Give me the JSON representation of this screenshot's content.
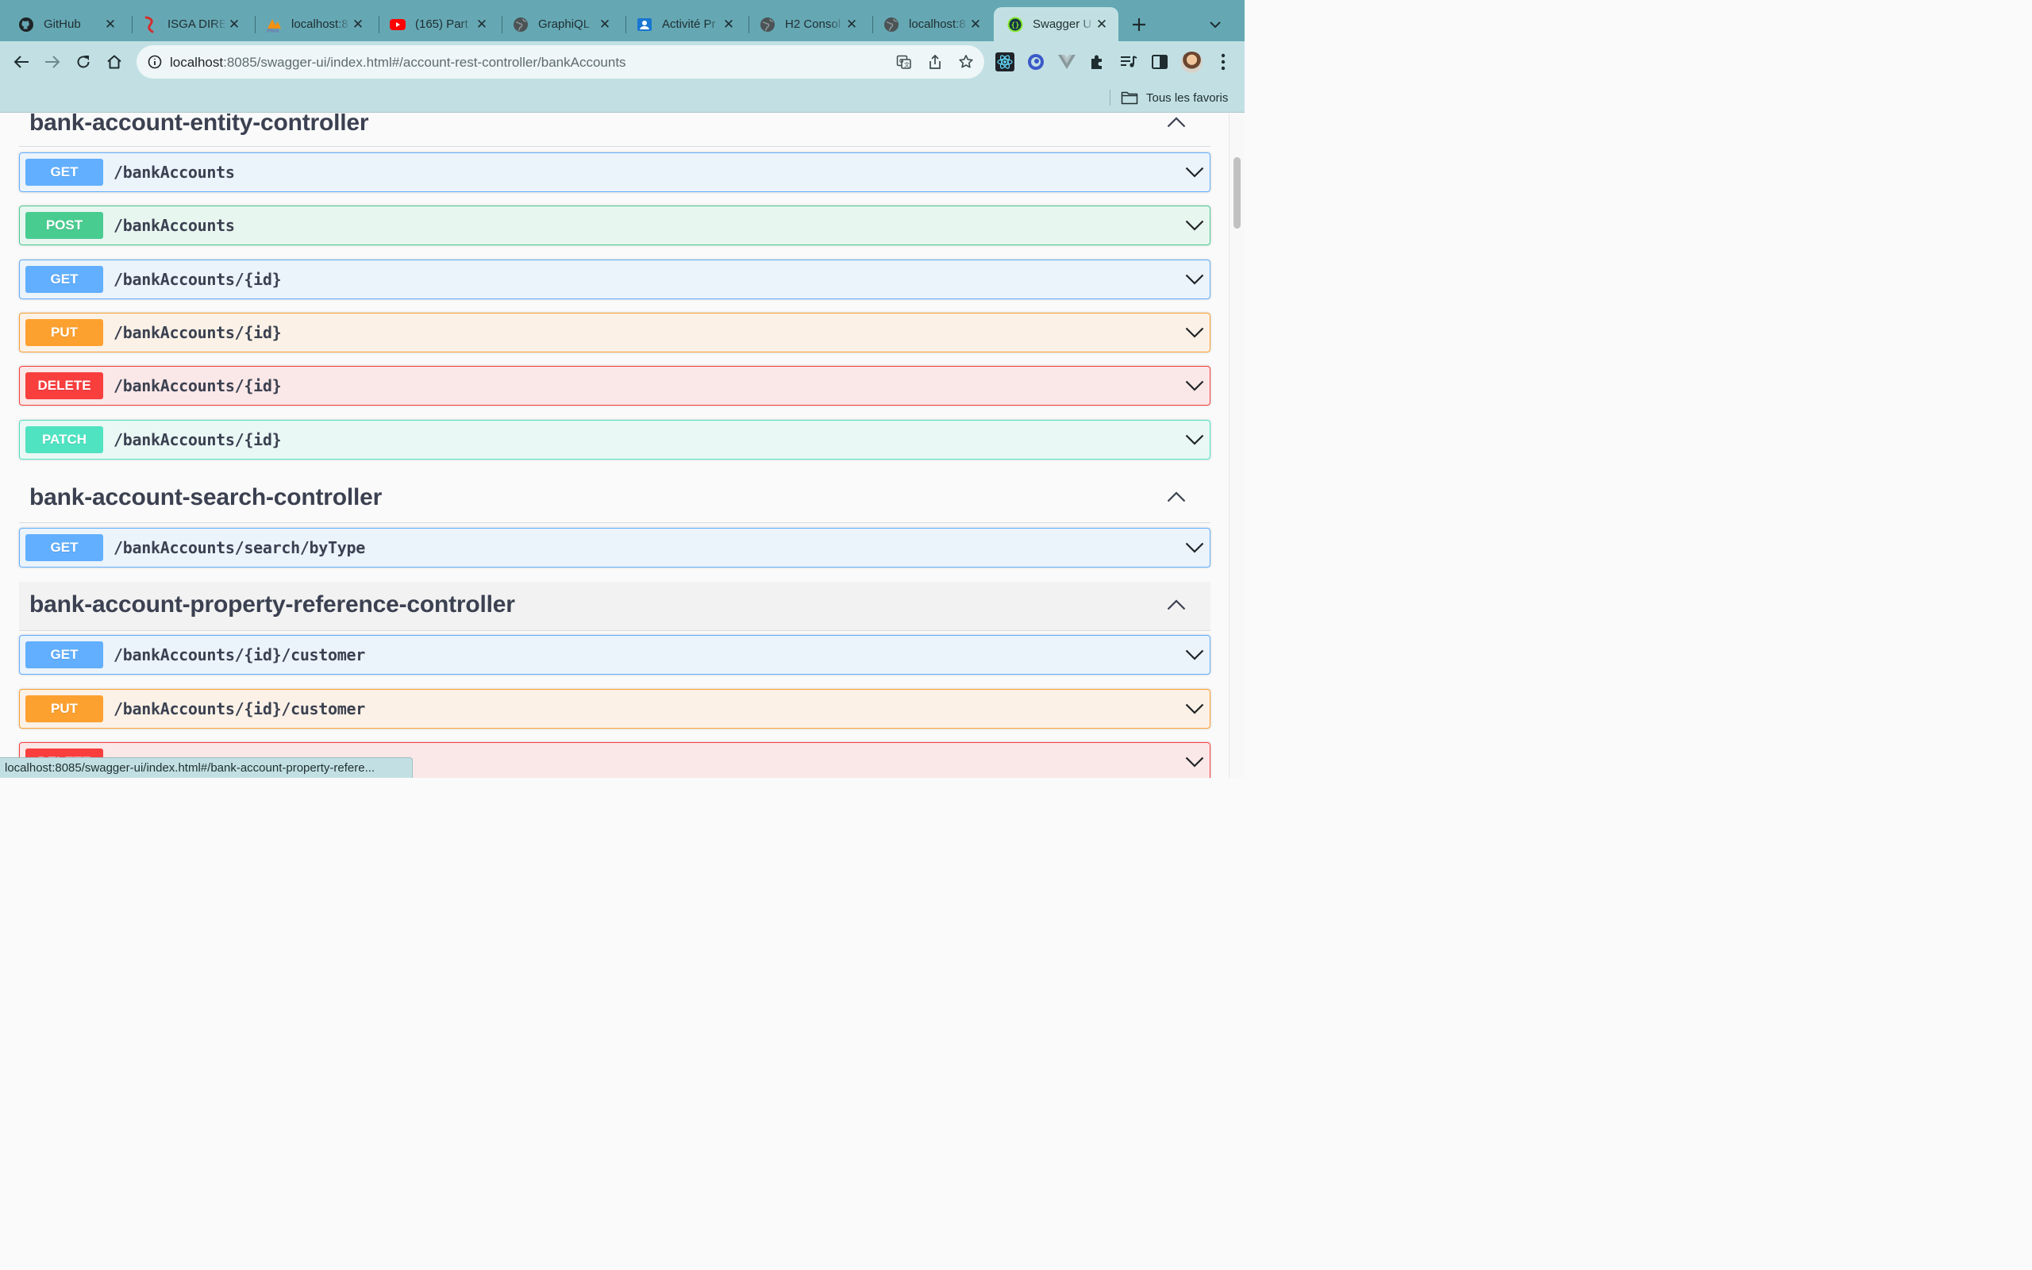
{
  "browser": {
    "tabs": [
      {
        "title": "GitHub",
        "icon": "github-icon"
      },
      {
        "title": "ISGA DIRE",
        "icon": "isga-icon"
      },
      {
        "title": "localhost:8",
        "icon": "phpmyadmin-icon"
      },
      {
        "title": "(165) Part",
        "icon": "youtube-icon"
      },
      {
        "title": "GraphiQL",
        "icon": "globe-icon"
      },
      {
        "title": "Activité Pr",
        "icon": "activity-icon"
      },
      {
        "title": "H2 Consol",
        "icon": "globe-icon"
      },
      {
        "title": "localhost:8",
        "icon": "globe-icon"
      },
      {
        "title": "Swagger U",
        "icon": "swagger-icon",
        "active": true
      }
    ],
    "url_host": "localhost",
    "url_rest": ":8085/swagger-ui/index.html#/account-rest-controller/bankAccounts",
    "bookmarks_folder": "Tous les favoris",
    "status_url": "localhost:8085/swagger-ui/index.html#/bank-account-property-refere..."
  },
  "swagger": {
    "sections": [
      {
        "title": "bank-account-entity-controller",
        "operations": [
          {
            "method": "GET",
            "path": "/bankAccounts"
          },
          {
            "method": "POST",
            "path": "/bankAccounts"
          },
          {
            "method": "GET",
            "path": "/bankAccounts/{id}"
          },
          {
            "method": "PUT",
            "path": "/bankAccounts/{id}"
          },
          {
            "method": "DELETE",
            "path": "/bankAccounts/{id}"
          },
          {
            "method": "PATCH",
            "path": "/bankAccounts/{id}"
          }
        ]
      },
      {
        "title": "bank-account-search-controller",
        "operations": [
          {
            "method": "GET",
            "path": "/bankAccounts/search/byType"
          }
        ]
      },
      {
        "title": "bank-account-property-reference-controller",
        "operations": [
          {
            "method": "GET",
            "path": "/bankAccounts/{id}/customer"
          },
          {
            "method": "PUT",
            "path": "/bankAccounts/{id}/customer"
          },
          {
            "method": "DELETE",
            "path": ""
          }
        ]
      }
    ]
  },
  "colors": {
    "get": "#61affe",
    "post": "#49cc90",
    "put": "#fca130",
    "delete": "#f93e3e",
    "patch": "#50e3c2",
    "chrome_frame": "#65a8b4",
    "chrome_toolbar": "#c2e0e3"
  }
}
